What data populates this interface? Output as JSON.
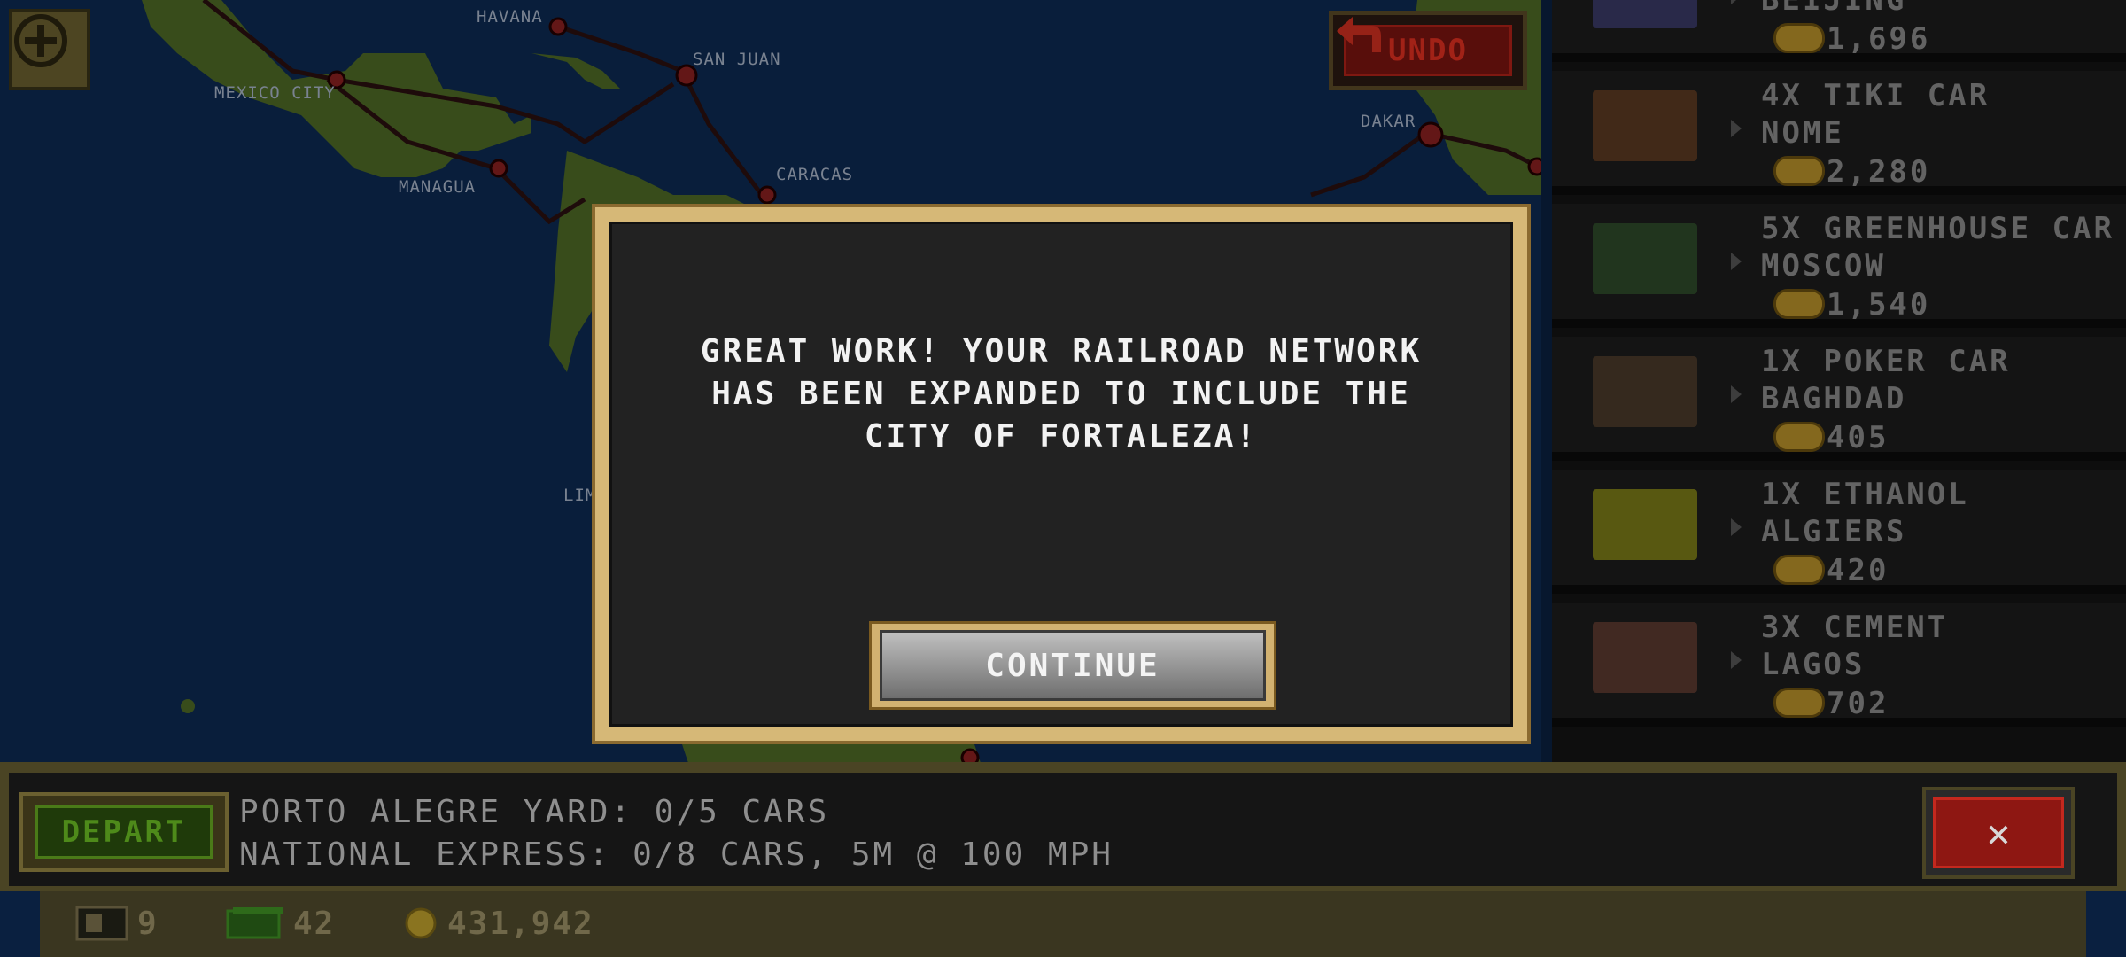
{
  "map": {
    "cities": [
      "HAVANA",
      "SAN JUAN",
      "MEXICO CITY",
      "MANAGUA",
      "CARACAS",
      "DAKAR",
      "LIM"
    ]
  },
  "undo_label": "UNDO",
  "cargo_list": [
    {
      "line1": "",
      "line2": "BEIJING",
      "value": "1,696",
      "thumb_color": "#3a3a66"
    },
    {
      "line1": "4X TIKI CAR",
      "line2": "NOME",
      "value": "2,280",
      "thumb_color": "#5a3a22"
    },
    {
      "line1": "5X GREENHOUSE CAR",
      "line2": "MOSCOW",
      "value": "1,540",
      "thumb_color": "#2e4a2a"
    },
    {
      "line1": "1X POKER CAR",
      "line2": "BAGHDAD",
      "value": "405",
      "thumb_color": "#4a3a2a"
    },
    {
      "line1": "1X ETHANOL",
      "line2": "ALGIERS",
      "value": "420",
      "thumb_color": "#7a7a18"
    },
    {
      "line1": "3X CEMENT",
      "line2": "LAGOS",
      "value": "702",
      "thumb_color": "#5a3a30"
    }
  ],
  "dialog": {
    "message": "GREAT WORK! YOUR RAILROAD NETWORK HAS BEEN EXPANDED TO INCLUDE THE CITY OF FORTALEZA!",
    "continue_label": "CONTINUE"
  },
  "bottom": {
    "depart_label": "DEPART",
    "yard_status": "PORTO ALEGRE YARD: 0/5 CARS",
    "train_status": "NATIONAL EXPRESS: 0/8 CARS, 5M @ 100 MPH",
    "close_label": "✕"
  },
  "resources": {
    "cars": "9",
    "cash": "42",
    "coins": "431,942"
  },
  "colors": {
    "ocean": "#0d2a52",
    "land": "#4e6a26",
    "rail": "#2a1010",
    "accent_gold": "#d6b877"
  }
}
